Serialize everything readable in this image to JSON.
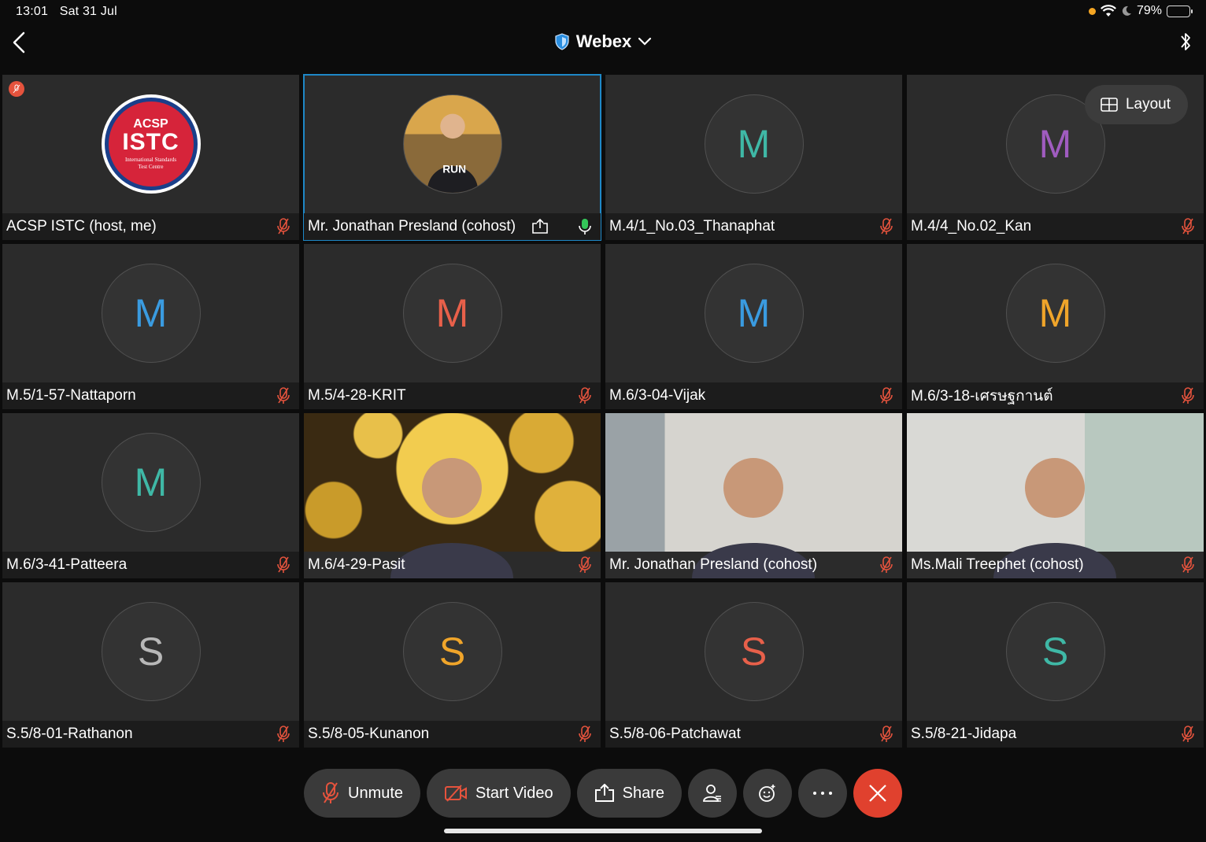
{
  "status_bar": {
    "time": "13:01",
    "date": "Sat 31 Jul",
    "battery_text": "79%",
    "battery_level": 0.79
  },
  "header": {
    "title": "Webex",
    "icons": [
      "back-icon",
      "shield-icon",
      "chevron-down-icon",
      "bluetooth-icon"
    ]
  },
  "layout_button": {
    "label": "Layout"
  },
  "colors": {
    "accent": "#1e88c7",
    "muted_mic": "#e5533d",
    "active_mic": "#34c759",
    "leave": "#e0412e"
  },
  "tiles": [
    {
      "name": "ACSP ISTC (host, me)",
      "avatar_type": "logo",
      "logo_top": "ACSP",
      "logo_main": "ISTC",
      "logo_sub1": "International Standards",
      "logo_sub2": "Test Centre",
      "mic": "muted"
    },
    {
      "name": "Mr. Jonathan Presland (cohost)",
      "avatar_type": "photo",
      "mic": "active",
      "sharing": true,
      "active": true
    },
    {
      "name": "M.4/1_No.03_Thanaphat",
      "avatar_type": "letter",
      "letter": "M",
      "color": "#3fb8a6",
      "mic": "muted"
    },
    {
      "name": "M.4/4_No.02_Kan",
      "avatar_type": "letter",
      "letter": "M",
      "color": "#a05cc0",
      "mic": "muted"
    },
    {
      "name": "M.5/1-57-Nattaporn",
      "avatar_type": "letter",
      "letter": "M",
      "color": "#3a9be0",
      "mic": "muted"
    },
    {
      "name": "M.5/4-28-KRIT",
      "avatar_type": "letter",
      "letter": "M",
      "color": "#e8604a",
      "mic": "muted"
    },
    {
      "name": "M.6/3-04-Vijak",
      "avatar_type": "letter",
      "letter": "M",
      "color": "#3a9be0",
      "mic": "muted"
    },
    {
      "name": "M.6/3-18-เศรษฐกานต์",
      "avatar_type": "letter",
      "letter": "M",
      "color": "#f0a52a",
      "mic": "muted"
    },
    {
      "name": "M.6/3-41-Patteera",
      "avatar_type": "letter",
      "letter": "M",
      "color": "#3fb8a6",
      "mic": "muted"
    },
    {
      "name": "M.6/4-29-Pasit",
      "avatar_type": "video",
      "scene": "scene-ai",
      "mic": "muted"
    },
    {
      "name": "Mr. Jonathan Presland (cohost)",
      "avatar_type": "video",
      "scene": "scene-room",
      "mic": "muted"
    },
    {
      "name": "Ms.Mali Treephet (cohost)",
      "avatar_type": "video",
      "scene": "scene-room2",
      "mic": "muted"
    },
    {
      "name": "S.5/8-01-Rathanon",
      "avatar_type": "letter",
      "letter": "S",
      "color": "#b8b8b8",
      "mic": "muted"
    },
    {
      "name": "S.5/8-05-Kunanon",
      "avatar_type": "letter",
      "letter": "S",
      "color": "#f0a52a",
      "mic": "muted"
    },
    {
      "name": "S.5/8-06-Patchawat",
      "avatar_type": "letter",
      "letter": "S",
      "color": "#e8604a",
      "mic": "muted"
    },
    {
      "name": "S.5/8-21-Jidapa",
      "avatar_type": "letter",
      "letter": "S",
      "color": "#3fb8a6",
      "mic": "muted"
    }
  ],
  "toolbar": {
    "unmute_label": "Unmute",
    "start_video_label": "Start Video",
    "share_label": "Share"
  }
}
